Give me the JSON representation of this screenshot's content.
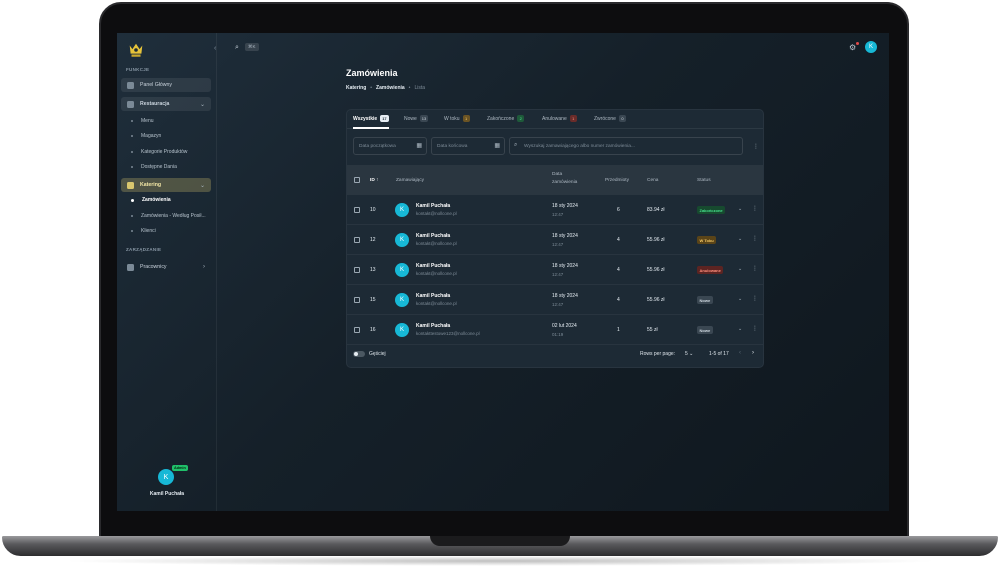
{
  "sidebar": {
    "section_funkcje": "FUNKCJE",
    "section_zarzadzanie": "ZARZĄDZANIE",
    "collapse_icon": "‹",
    "items": {
      "panel": "Panel Główny",
      "restauracja": "Restauracja",
      "menu": "Menu",
      "magazyn": "Magazyn",
      "kategorie": "Kategorie Produktów",
      "dania": "Dostępne Dania",
      "katering": "Katering",
      "zamowienia": "Zamówienia",
      "zamowienia_pos": "Zamówienia - Według Posił...",
      "klienci": "Klienci",
      "pracownicy": "Pracownicy"
    },
    "user": {
      "initial": "K",
      "badge": "Admin",
      "name": "Kamil Puchała"
    }
  },
  "topbar": {
    "search_icon": "search-icon",
    "shortcut": "⌘K",
    "avatar_initial": "K"
  },
  "page": {
    "title": "Zamówienia",
    "breadcrumb": [
      "Katering",
      "Zamówienia",
      "Lista"
    ]
  },
  "tabs": [
    {
      "label": "Wszystkie",
      "count": "17",
      "color": "#ffffff",
      "bg": "#e6edf3",
      "fg": "#1d2a35"
    },
    {
      "label": "Nowe",
      "count": "13",
      "bg": "#3a4752",
      "fg": "#cfd8e0"
    },
    {
      "label": "W toku",
      "count": "1",
      "bg": "#6b5424",
      "fg": "#f5c865"
    },
    {
      "label": "Zakończone",
      "count": "2",
      "bg": "#1e5a3a",
      "fg": "#4fe08f"
    },
    {
      "label": "Anulowane",
      "count": "1",
      "bg": "#6a2c2a",
      "fg": "#ff8f7d"
    },
    {
      "label": "Zwrócone",
      "count": "0",
      "bg": "#3a4752",
      "fg": "#cfd8e0"
    }
  ],
  "filters": {
    "start_placeholder": "Data początkowa",
    "end_placeholder": "Data końcowa",
    "search_placeholder": "Wyszukaj zamawiającego albo numer zamówienia..."
  },
  "table": {
    "headers": {
      "id": "ID",
      "customer": "Zamawiający",
      "date_line1": "Data",
      "date_line2": "zamówienia",
      "items": "Przedmioty",
      "price": "Cena",
      "status": "Status"
    },
    "rows": [
      {
        "id": "10",
        "initial": "K",
        "name": "Kamil Puchała",
        "email": "kontakt@nollcone.pl",
        "date": "18 sty 2024",
        "time": "12:47",
        "items": "6",
        "price": "83.94 zł",
        "status": "Zakończone",
        "status_bg": "#174a2f",
        "status_fg": "#45e08c"
      },
      {
        "id": "12",
        "initial": "K",
        "name": "Kamil Puchała",
        "email": "kontakt@nollcone.pl",
        "date": "18 sty 2024",
        "time": "12:47",
        "items": "4",
        "price": "55.96 zł",
        "status": "W Toku",
        "status_bg": "#5a4418",
        "status_fg": "#f5c865"
      },
      {
        "id": "13",
        "initial": "K",
        "name": "Kamil Puchała",
        "email": "kontakt@nollcone.pl",
        "date": "18 sty 2024",
        "time": "12:47",
        "items": "4",
        "price": "55.96 zł",
        "status": "Anulowane",
        "status_bg": "#5c2422",
        "status_fg": "#ff8f7d"
      },
      {
        "id": "15",
        "initial": "K",
        "name": "Kamil Puchała",
        "email": "kontakt@nollcone.pl",
        "date": "18 sty 2024",
        "time": "12:47",
        "items": "4",
        "price": "55.96 zł",
        "status": "Nowe",
        "status_bg": "#3a4752",
        "status_fg": "#cfd8e0"
      },
      {
        "id": "16",
        "initial": "K",
        "name": "Kamil Puchała",
        "email": "kontakttestowe123@nollcone.pl",
        "date": "02 lut 2024",
        "time": "01:19",
        "items": "1",
        "price": "55 zł",
        "status": "Nowe",
        "status_bg": "#3a4752",
        "status_fg": "#cfd8e0"
      }
    ]
  },
  "footer": {
    "dense_label": "Gęściej",
    "rows_per_page_label": "Rows per page:",
    "rows_per_page": "5",
    "range": "1-5 of 17"
  }
}
